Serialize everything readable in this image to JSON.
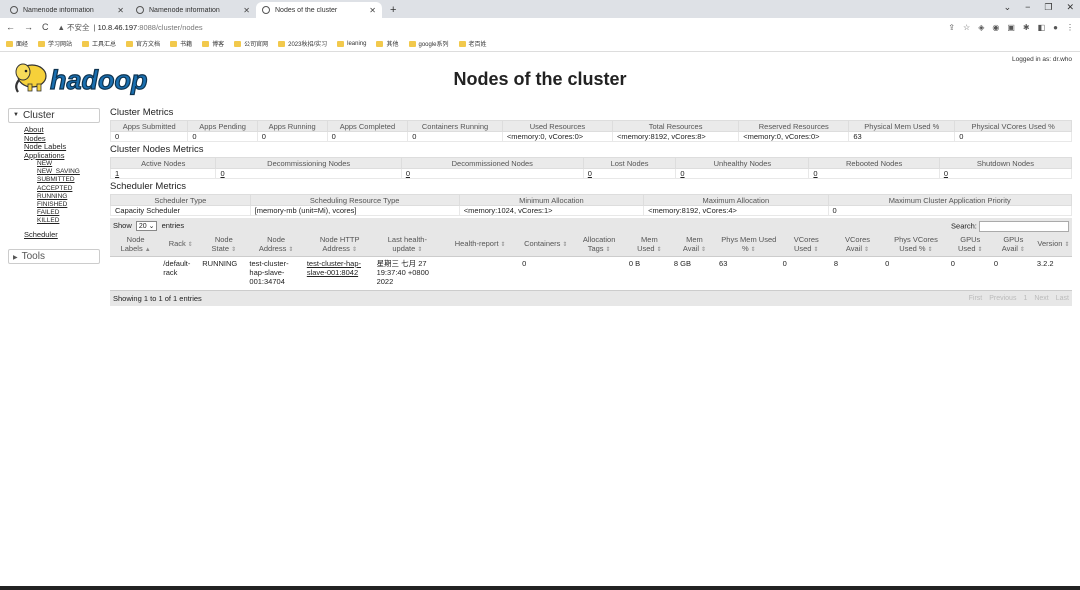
{
  "browser": {
    "tabs": [
      {
        "label": "Namenode information",
        "active": false
      },
      {
        "label": "Namenode information",
        "active": false
      },
      {
        "label": "Nodes of the cluster",
        "active": true
      }
    ],
    "url_warning": "▲ 不安全",
    "url_host": "10.8.46.197",
    "url_path": ":8088/cluster/nodes",
    "bookmarks": [
      "面经",
      "学习网站",
      "工具汇总",
      "官方文档",
      "书籍",
      "博客",
      "公司官网",
      "2023秋招/实习",
      "leaning",
      "其他",
      "google系列",
      "老百姓"
    ]
  },
  "page": {
    "title": "Nodes of the cluster",
    "logged_in": "Logged in as: dr.who",
    "logo_text": "hadoop"
  },
  "nav": {
    "cluster_label": "Cluster",
    "links": [
      "About",
      "Nodes",
      "Node Labels",
      "Applications"
    ],
    "app_states": [
      "NEW",
      "NEW_SAVING",
      "SUBMITTED",
      "ACCEPTED",
      "RUNNING",
      "FINISHED",
      "FAILED",
      "KILLED"
    ],
    "scheduler": "Scheduler",
    "tools_label": "Tools"
  },
  "cluster_metrics": {
    "title": "Cluster Metrics",
    "headers": [
      "Apps Submitted",
      "Apps Pending",
      "Apps Running",
      "Apps Completed",
      "Containers Running",
      "Used Resources",
      "Total Resources",
      "Reserved Resources",
      "Physical Mem Used %",
      "Physical VCores Used %"
    ],
    "values": [
      "0",
      "0",
      "0",
      "0",
      "0",
      "<memory:0, vCores:0>",
      "<memory:8192, vCores:8>",
      "<memory:0, vCores:0>",
      "63",
      "0"
    ]
  },
  "node_metrics": {
    "title": "Cluster Nodes Metrics",
    "headers": [
      "Active Nodes",
      "Decommissioning Nodes",
      "Decommissioned Nodes",
      "Lost Nodes",
      "Unhealthy Nodes",
      "Rebooted Nodes",
      "Shutdown Nodes"
    ],
    "values": [
      "1",
      "0",
      "0",
      "0",
      "0",
      "0",
      "0"
    ]
  },
  "scheduler_metrics": {
    "title": "Scheduler Metrics",
    "headers": [
      "Scheduler Type",
      "Scheduling Resource Type",
      "Minimum Allocation",
      "Maximum Allocation",
      "Maximum Cluster Application Priority"
    ],
    "values": [
      "Capacity Scheduler",
      "[memory-mb (unit=Mi), vcores]",
      "<memory:1024, vCores:1>",
      "<memory:8192, vCores:4>",
      "0"
    ]
  },
  "table_controls": {
    "show_label": "Show",
    "entries_value": "20",
    "entries_label": "entries",
    "search_label": "Search:"
  },
  "nodes_table": {
    "headers": [
      "Node Labels",
      "Rack",
      "Node State",
      "Node Address",
      "Node HTTP Address",
      "Last health-update",
      "Health-report",
      "Containers",
      "Allocation Tags",
      "Mem Used",
      "Mem Avail",
      "Phys Mem Used %",
      "VCores Used",
      "VCores Avail",
      "Phys VCores Used %",
      "GPUs Used",
      "GPUs Avail",
      "Version"
    ],
    "rows": [
      [
        "",
        "/default-rack",
        "RUNNING",
        "test-cluster-hap-slave-001:34704",
        "test-cluster-hap-slave-001:8042",
        "星期三 七月 27 19:37:40 +0800 2022",
        "",
        "0",
        "",
        "0 B",
        "8 GB",
        "63",
        "0",
        "8",
        "0",
        "0",
        "0",
        "3.2.2"
      ]
    ]
  },
  "footer": {
    "info": "Showing 1 to 1 of 1 entries",
    "pager": [
      "First",
      "Previous",
      "1",
      "Next",
      "Last"
    ]
  }
}
